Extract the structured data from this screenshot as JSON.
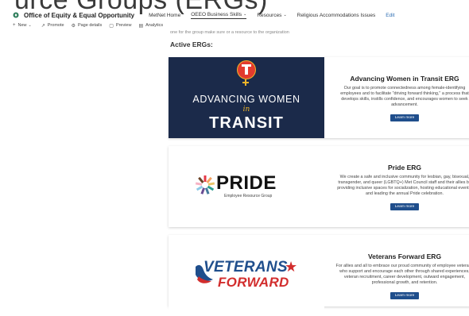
{
  "header": {
    "page_title_partial": "urce Groups (ERGs)",
    "site_name": "Office of Equity & Equal Opportunity",
    "nav": [
      {
        "label": "MetNet Home",
        "chevron": false,
        "active": false
      },
      {
        "label": "OEEO Business Skills",
        "chevron": true,
        "active": true
      },
      {
        "label": "Resources",
        "chevron": true,
        "active": false
      },
      {
        "label": "Religious Accommodations Issues",
        "chevron": false,
        "active": false
      }
    ],
    "edit_label": "Edit"
  },
  "commands": [
    {
      "icon": "+",
      "label": "New",
      "chevron": true
    },
    {
      "icon": "↗",
      "label": "Promote"
    },
    {
      "icon": "⚙",
      "label": "Page details"
    },
    {
      "icon": "▢",
      "label": "Preview"
    },
    {
      "icon": "▤",
      "label": "Analytics"
    }
  ],
  "faded_text": "one for the group make sure or a resource to the organization",
  "section_heading": "Active ERGs:",
  "ergs": [
    {
      "title": "Advancing Women in Transit ERG",
      "description": "Our goal is to promote connectedness among female-identifying employees and to facilitate \"driving forward thinking,\" a process that develops skills, instills confidence, and encourages women to seek advancement.",
      "button": "Learn more",
      "banner_line1": "ADVANCING WOMEN",
      "banner_in": "in",
      "banner_line2": "TRANSIT"
    },
    {
      "title": "Pride ERG",
      "description": "We create a safe and inclusive community for lesbian, gay, bisexual, transgender, and queer (LGBTQ+) Met Council staff and their allies by providing inclusive spaces for socialization, hosting educational events, and leading the annual Pride celebration.",
      "button": "Learn more",
      "banner_word": "PRIDE",
      "banner_sub": "Employee Resource Group"
    },
    {
      "title": "Veterans Forward ERG",
      "description": "For allies and all to embrace our proud community of employee veterans who support and encourage each other through shared experiences, veteran recruitment, career development, outward engagement, professional growth, and retention.",
      "button": "Learn more",
      "banner_word1": "VETERANS",
      "banner_word2": "FORWARD"
    }
  ],
  "colors": {
    "button_bg": "#1f4e8c",
    "transit_bg": "#1b2a4a",
    "transit_red": "#e23b2e",
    "transit_gold": "#f0b429",
    "veterans_blue": "#1f4e8c",
    "veterans_red": "#d22d2d"
  }
}
